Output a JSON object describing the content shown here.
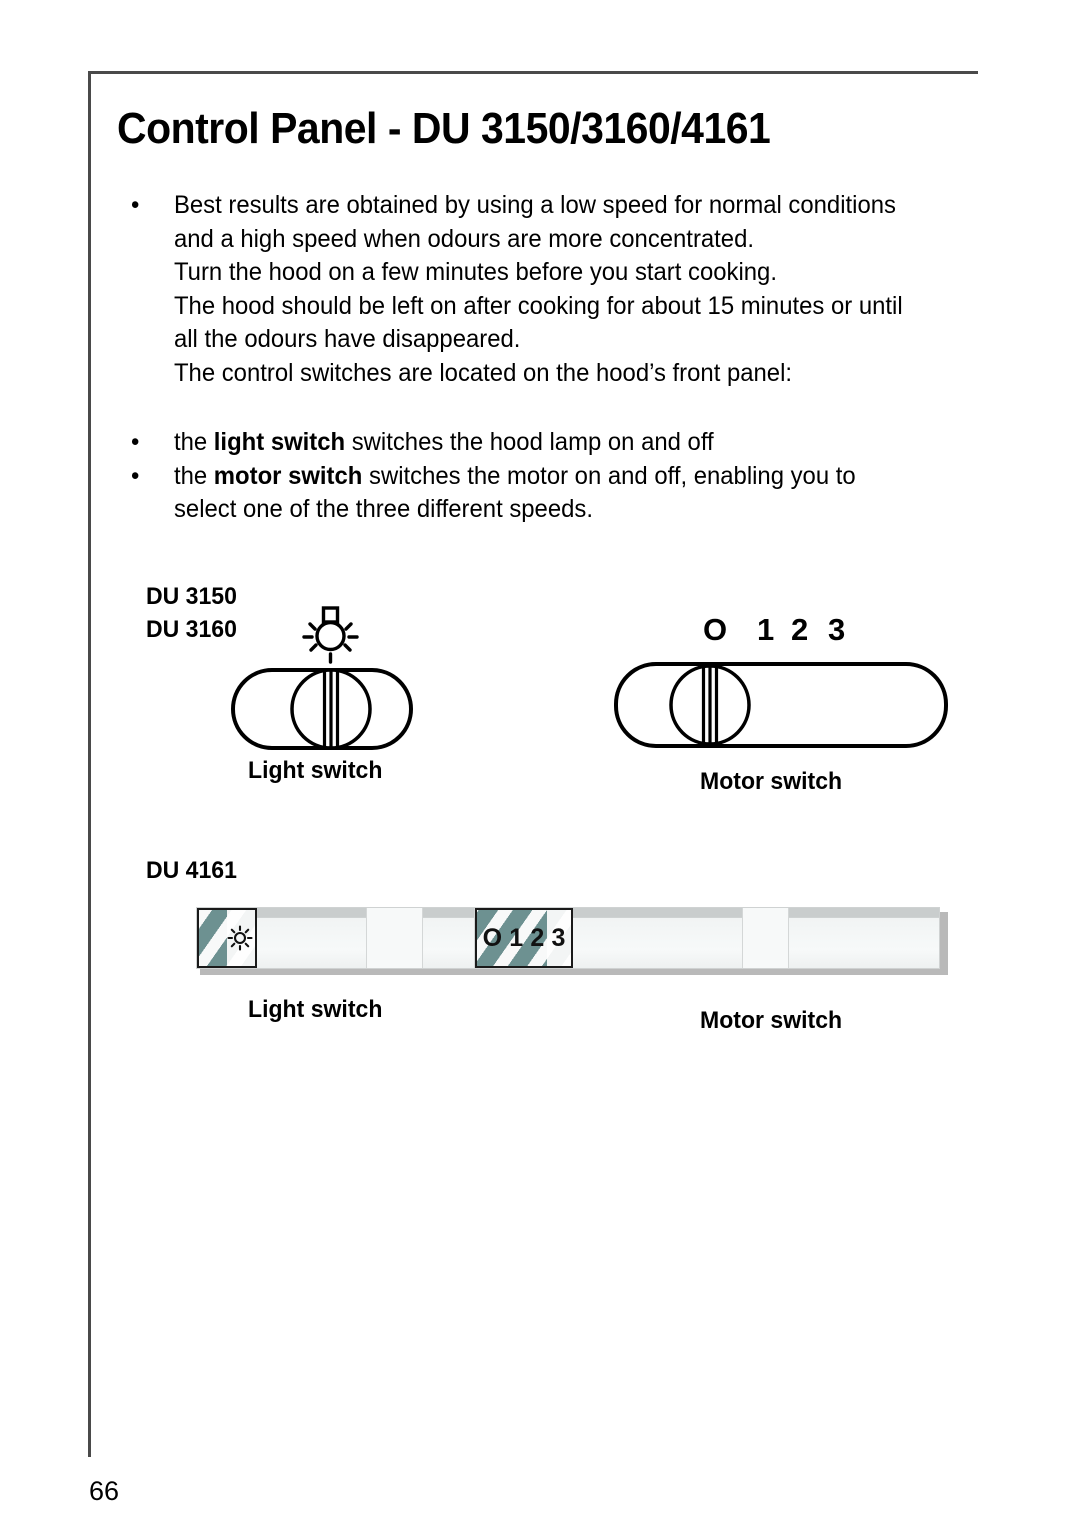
{
  "page": {
    "title": "Control Panel - DU 3150/3160/4161",
    "number": "66"
  },
  "intro": {
    "bullet": "•",
    "lines": [
      "Best results are obtained by using a low speed for normal conditions",
      "and a high speed when odours are more concentrated.",
      "Turn the hood on a few minutes before you start cooking.",
      "The hood should be left on after cooking for about 15 minutes or until",
      "all the odours have disappeared.",
      "The control switches are located on the hood’s front panel:"
    ]
  },
  "switch_list": {
    "bullet": "•",
    "items": [
      {
        "prefix": "the ",
        "strong": "light switch",
        "suffix": " switches the hood lamp on and off",
        "second_line": ""
      },
      {
        "prefix": "the ",
        "strong": "motor switch",
        "suffix": " switches the motor on and off, enabling you to",
        "second_line": "select one of the three different speeds."
      }
    ]
  },
  "diagram_rocker": {
    "model_line_1": "DU 3150",
    "model_line_2": "DU 3160",
    "light_switch_caption": "Light switch",
    "motor_switch_caption": "Motor switch",
    "motor_scale": [
      "O",
      "1",
      "2",
      "3"
    ],
    "light_icon": "light-bulb-icon"
  },
  "diagram_fascia": {
    "model_label": "DU 4161",
    "light_switch_caption": "Light switch",
    "motor_switch_caption": "Motor switch",
    "motor_button_digits": [
      "O",
      "1",
      "2",
      "3"
    ],
    "light_icon": "sun-icon"
  },
  "colors": {
    "ink": "#000000",
    "frame_rule": "#4a4a4a",
    "button_teal": "#6d9191",
    "fascia_face": "#f4f6f6",
    "fascia_shade": "#c9cdcd",
    "fascia_shadow": "#b9b9b9"
  }
}
